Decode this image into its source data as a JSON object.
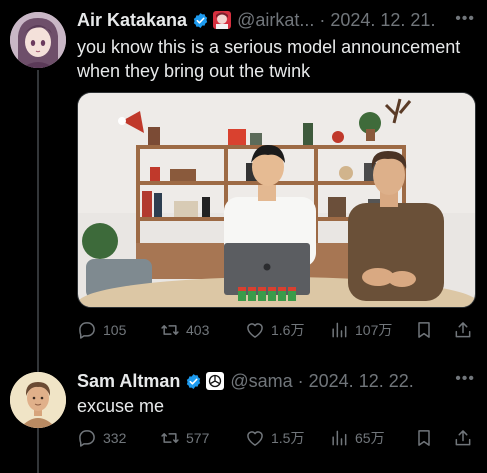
{
  "tweets": [
    {
      "name": "Air Katakana",
      "handle": "@airkat... · 2024. 12. 21.",
      "text": "you know this is a serious model announcement when they bring out the twink",
      "avatar_icon": "anime-girl-avatar",
      "badge_icon": "anime-badge-icon",
      "stats": {
        "replies": "105",
        "retweets": "403",
        "likes": "1.6万",
        "views": "107万"
      }
    },
    {
      "name": "Sam Altman",
      "handle": "@sama · 2024. 12. 22.",
      "text": "excuse me",
      "avatar_icon": "cartoon-man-avatar",
      "badge_icon": "openai-logo-icon",
      "stats": {
        "replies": "332",
        "retweets": "577",
        "likes": "1.5万",
        "views": "65万"
      }
    }
  ],
  "colors": {
    "background": "#000000",
    "text": "#e7e9ea",
    "muted": "#71767b",
    "verified": "#1d9bf0",
    "line": "#333639"
  }
}
